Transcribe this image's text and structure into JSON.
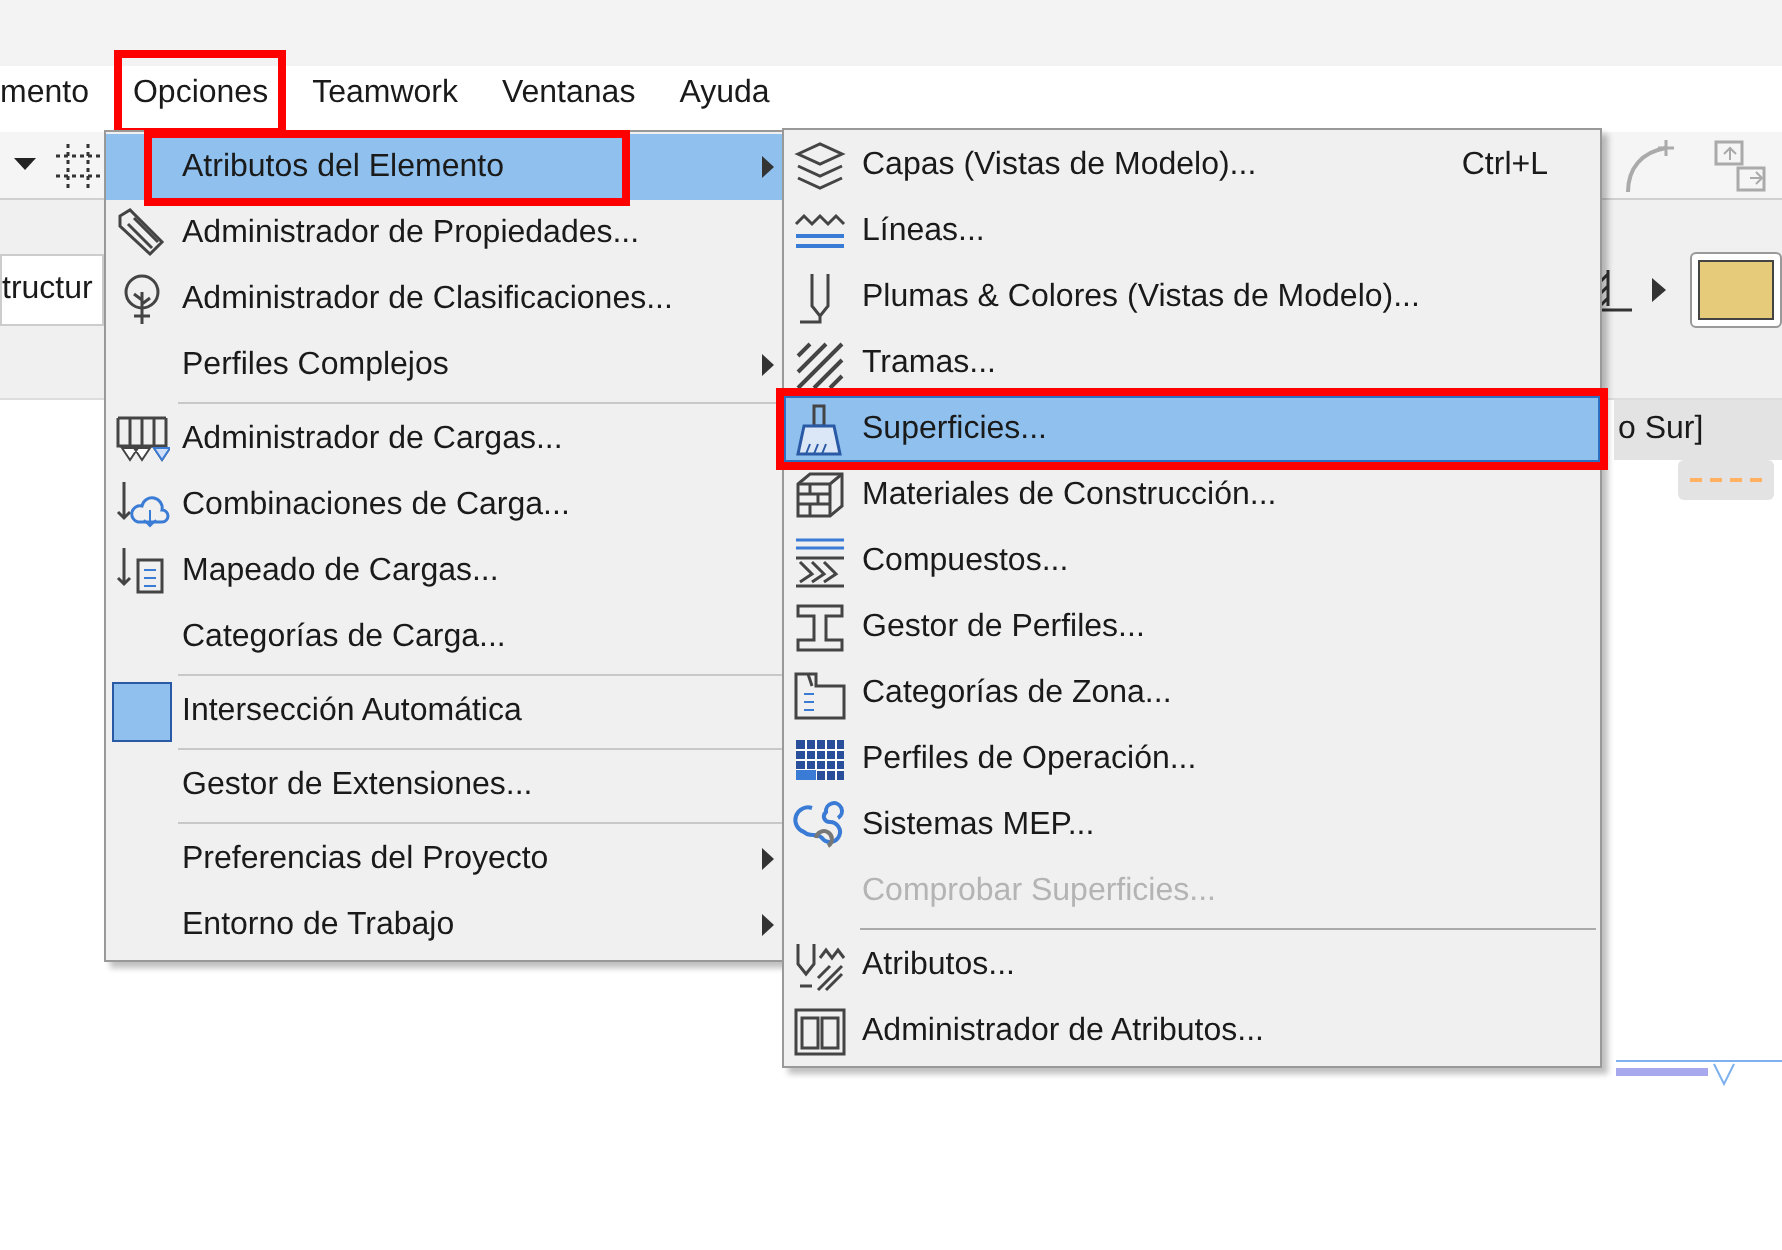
{
  "menubar": [
    {
      "label": "mento",
      "annotated": false
    },
    {
      "label": "Opciones",
      "annotated": true
    },
    {
      "label": "Teamwork",
      "annotated": false
    },
    {
      "label": "Ventanas",
      "annotated": false
    },
    {
      "label": "Ayuda",
      "annotated": false
    }
  ],
  "toolbar": {
    "field_value": "tructur",
    "tab_label": "o Sur]"
  },
  "options_menu": [
    {
      "kind": "item",
      "label": "Atributos del Elemento",
      "selected": true,
      "checked": false,
      "submenu": true,
      "annotated": true
    },
    {
      "kind": "item",
      "label": "Administrador de Propiedades...",
      "selected": false,
      "checked": false,
      "submenu": false,
      "annotated": false
    },
    {
      "kind": "item",
      "label": "Administrador de Clasificaciones...",
      "selected": false,
      "checked": false,
      "submenu": false,
      "annotated": false
    },
    {
      "kind": "item",
      "label": "Perfiles Complejos",
      "selected": false,
      "checked": false,
      "submenu": true,
      "annotated": false
    },
    {
      "kind": "separator"
    },
    {
      "kind": "item",
      "label": "Administrador de Cargas...",
      "selected": false,
      "checked": false,
      "submenu": false,
      "annotated": false
    },
    {
      "kind": "item",
      "label": "Combinaciones de Carga...",
      "selected": false,
      "checked": false,
      "submenu": false,
      "annotated": false
    },
    {
      "kind": "item",
      "label": "Mapeado de Cargas...",
      "selected": false,
      "checked": false,
      "submenu": false,
      "annotated": false
    },
    {
      "kind": "item",
      "label": "Categorías de Carga...",
      "selected": false,
      "checked": false,
      "submenu": false,
      "annotated": false
    },
    {
      "kind": "separator"
    },
    {
      "kind": "item",
      "label": "Intersección Automática",
      "selected": false,
      "checked": true,
      "submenu": false,
      "annotated": false
    },
    {
      "kind": "separator"
    },
    {
      "kind": "item",
      "label": "Gestor de Extensiones...",
      "selected": false,
      "checked": false,
      "submenu": false,
      "annotated": false
    },
    {
      "kind": "separator"
    },
    {
      "kind": "item",
      "label": "Preferencias del Proyecto",
      "selected": false,
      "checked": false,
      "submenu": true,
      "annotated": false
    },
    {
      "kind": "item",
      "label": "Entorno de Trabajo",
      "selected": false,
      "checked": false,
      "submenu": true,
      "annotated": false
    }
  ],
  "attributes_submenu": [
    {
      "kind": "item",
      "label": "Capas (Vistas de Modelo)...",
      "shortcut": "Ctrl+L",
      "selected": false,
      "disabled": false,
      "annotated": false
    },
    {
      "kind": "item",
      "label": "Líneas...",
      "selected": false,
      "disabled": false,
      "annotated": false
    },
    {
      "kind": "item",
      "label": "Plumas & Colores (Vistas de Modelo)...",
      "selected": false,
      "disabled": false,
      "annotated": false
    },
    {
      "kind": "item",
      "label": "Tramas...",
      "selected": false,
      "disabled": false,
      "annotated": false
    },
    {
      "kind": "item",
      "label": "Superficies...",
      "selected": true,
      "disabled": false,
      "annotated": true
    },
    {
      "kind": "item",
      "label": "Materiales de Construcción...",
      "selected": false,
      "disabled": false,
      "annotated": false
    },
    {
      "kind": "item",
      "label": "Compuestos...",
      "selected": false,
      "disabled": false,
      "annotated": false
    },
    {
      "kind": "item",
      "label": "Gestor de Perfiles...",
      "selected": false,
      "disabled": false,
      "annotated": false
    },
    {
      "kind": "item",
      "label": "Categorías de Zona...",
      "selected": false,
      "disabled": false,
      "annotated": false
    },
    {
      "kind": "item",
      "label": "Perfiles de Operación...",
      "selected": false,
      "disabled": false,
      "annotated": false
    },
    {
      "kind": "item",
      "label": "Sistemas MEP...",
      "selected": false,
      "disabled": false,
      "annotated": false
    },
    {
      "kind": "item",
      "label": "Comprobar Superficies...",
      "selected": false,
      "disabled": true,
      "annotated": false
    },
    {
      "kind": "separator"
    },
    {
      "kind": "item",
      "label": "Atributos...",
      "selected": false,
      "disabled": false,
      "annotated": false
    },
    {
      "kind": "item",
      "label": "Administrador de Atributos...",
      "selected": false,
      "disabled": false,
      "annotated": false
    }
  ]
}
